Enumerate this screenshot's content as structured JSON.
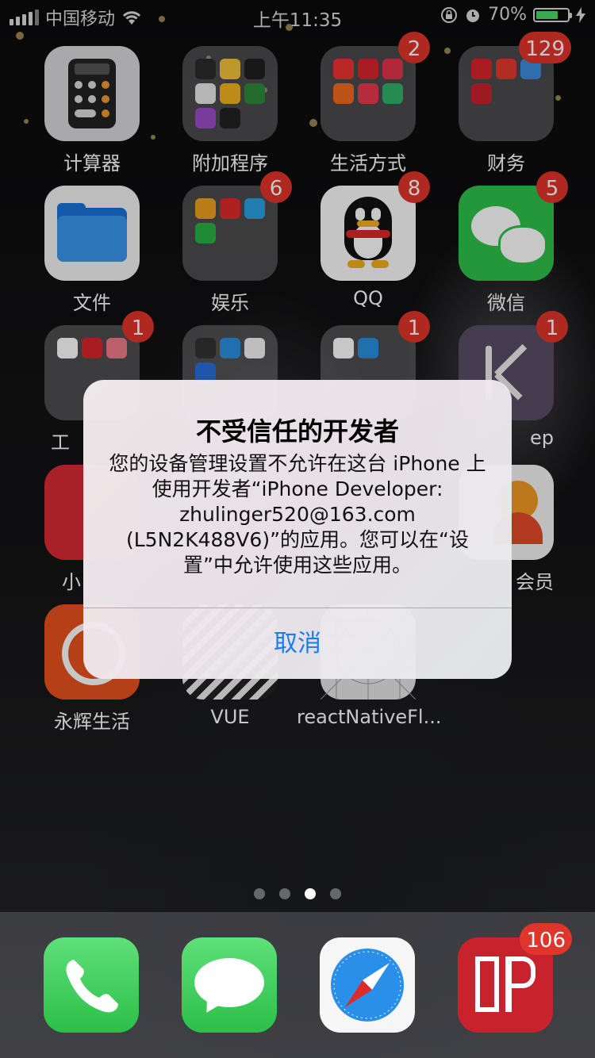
{
  "statusbar": {
    "carrier": "中国移动",
    "time": "上午11:35",
    "battery": "70%",
    "battery_level": 0.7
  },
  "apps": {
    "calculator": {
      "label": "计算器"
    },
    "extras": {
      "label": "附加程序"
    },
    "lifestyle": {
      "label": "生活方式",
      "badge": "2"
    },
    "finance": {
      "label": "财务",
      "badge": "129"
    },
    "files": {
      "label": "文件"
    },
    "entertainment": {
      "label": "娱乐",
      "badge": "6"
    },
    "qq": {
      "label": "QQ",
      "badge": "8"
    },
    "wechat": {
      "label": "微信",
      "badge": "5"
    },
    "tools": {
      "label": "工",
      "badge": "1"
    },
    "folder2": {
      "badge": ""
    },
    "folder3": {
      "badge": "1"
    },
    "keep": {
      "label": "ep",
      "badge": "1"
    },
    "xiao": {
      "label": "小"
    },
    "member": {
      "label": "会员"
    },
    "yonghui": {
      "label": "永辉生活"
    },
    "vue": {
      "label": "VUE"
    },
    "rn": {
      "label": "reactNativeFl..."
    }
  },
  "alert": {
    "title": "不受信任的开发者",
    "message": "您的设备管理设置不允许在这台 iPhone 上使用开发者“iPhone Developer: zhulinger520@163.com (L5N2K488V6)”的应用。您可以在“设置”中允许使用这些应用。",
    "cancel": "取消"
  },
  "page_dots": {
    "count": 4,
    "active": 3
  },
  "dock": {
    "phone": {
      "icon": "phone-icon"
    },
    "messages": {
      "icon": "messages-icon"
    },
    "safari": {
      "icon": "compass-icon"
    },
    "mail": {
      "badge": "106"
    }
  }
}
